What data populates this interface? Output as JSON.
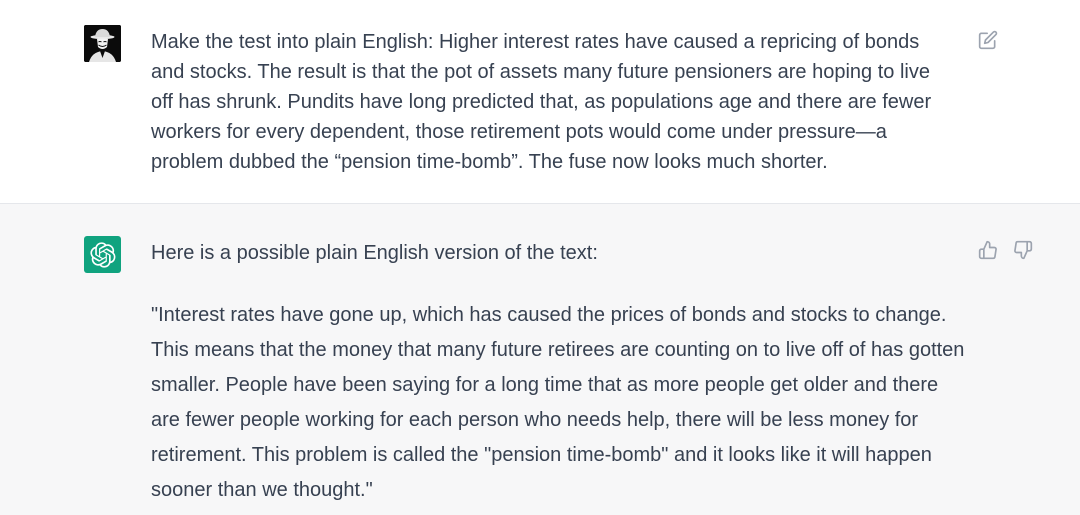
{
  "conversation": {
    "user_message": {
      "avatar_icon": "masked-figure-icon",
      "text": "Make the test into plain English: Higher interest rates have caused a repricing of bonds and stocks. The result is that the pot of assets many future pensioners are hoping to live off has shrunk. Pundits have long predicted that, as populations age and there are fewer workers for every dependent, those retirement pots would come under pressure—a problem dubbed the “pension time-bomb”. The fuse now looks much shorter.",
      "edit_icon": "edit-icon"
    },
    "assistant_message": {
      "avatar_icon": "openai-logo-icon",
      "avatar_color": "#10a37f",
      "intro": "Here is a possible plain English version of the text:",
      "body": "\"Interest rates have gone up, which has caused the prices of bonds and stocks to change. This means that the money that many future retirees are counting on to live off of has gotten smaller. People have been saying for a long time that as more people get older and there are fewer people working for each person who needs help, there will be less money for retirement. This problem is called the \"pension time-bomb\" and it looks like it will happen sooner than we thought.\"",
      "feedback": {
        "thumbs_up_icon": "thumbs-up-icon",
        "thumbs_down_icon": "thumbs-down-icon"
      }
    }
  },
  "colors": {
    "user_bg": "#ffffff",
    "assistant_bg": "#f7f7f8",
    "text": "#374151",
    "icon": "#9ca3af"
  }
}
